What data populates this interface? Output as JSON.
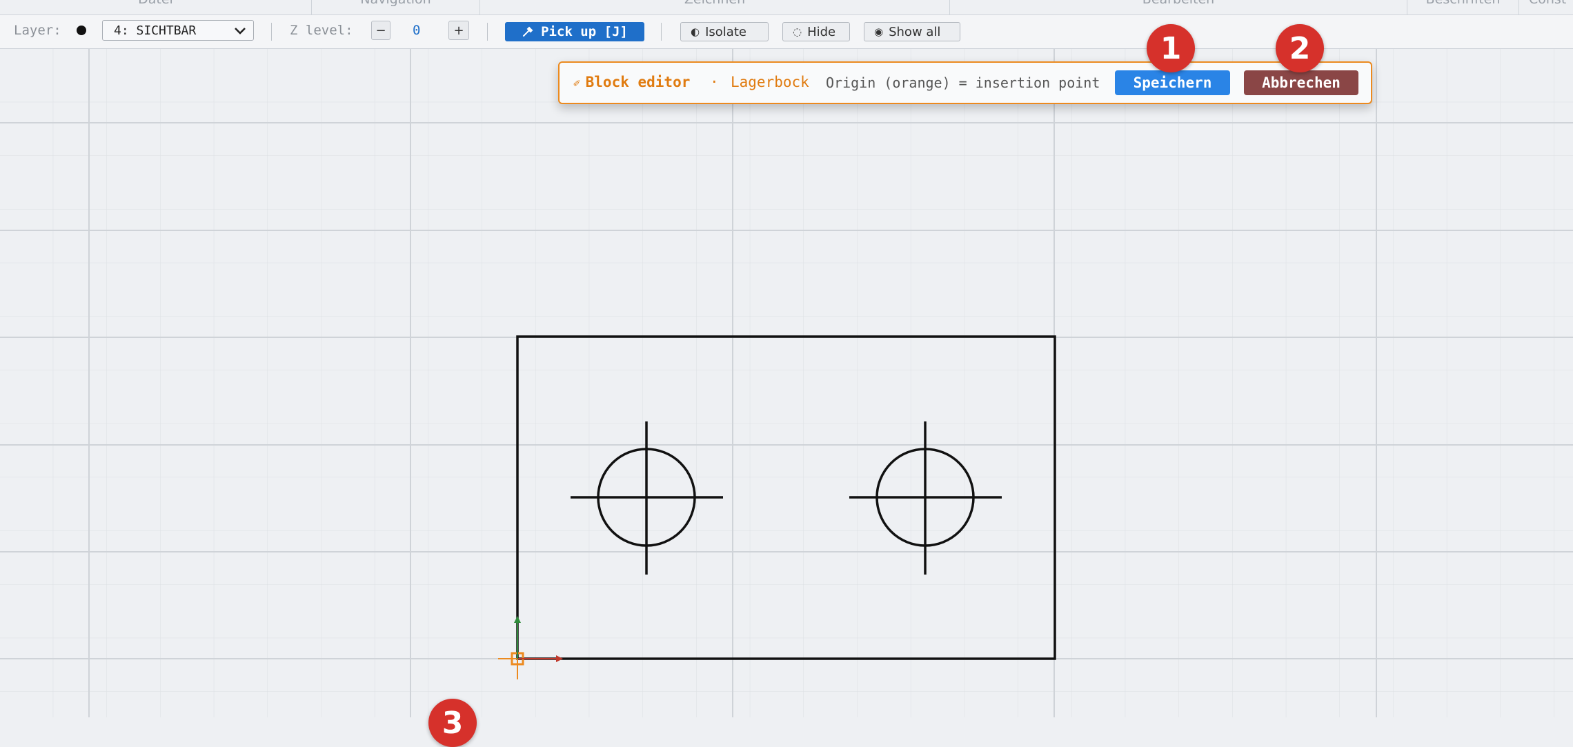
{
  "ribbon": {
    "groups": [
      "Datei",
      "Navigation",
      "Zeichnen",
      "Bearbeiten",
      "Beschriften",
      "Const"
    ]
  },
  "toolbar": {
    "layer_label": "Layer:",
    "layer_value": "4: SICHTBAR",
    "z_label": "Z level:",
    "z_minus": "−",
    "z_value": "0",
    "z_plus": "+",
    "pickup_label": "Pick up [J]",
    "isolate_label": "Isolate",
    "hide_label": "Hide",
    "showall_label": "Show all"
  },
  "banner": {
    "title": "Block editor",
    "separator": "·",
    "block_name": "Lagerbock",
    "hint": "Origin (orange) = insertion point",
    "save_label": "Speichern",
    "cancel_label": "Abbrechen"
  },
  "badges": [
    "1",
    "2",
    "3"
  ],
  "colors": {
    "accent": "#ec8a1f",
    "save": "#2a84e6",
    "cancel": "#8a4646",
    "pickup": "#1f6fc9",
    "badge": "#d6312b",
    "grid": "#d5d9de"
  },
  "icons": {
    "pickup": "eyedropper-icon",
    "isolate": "half-circle-icon",
    "hide": "dotted-circle-icon",
    "showall": "filled-circle-icon",
    "banner": "pencil-icon"
  }
}
